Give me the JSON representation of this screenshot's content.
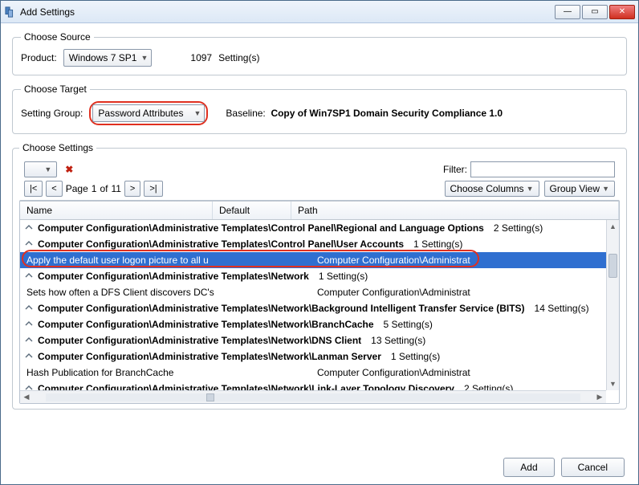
{
  "window": {
    "title": "Add Settings"
  },
  "source": {
    "legend": "Choose Source",
    "productLabel": "Product:",
    "productValue": "Windows 7 SP1",
    "count": "1097",
    "unit": "Setting(s)"
  },
  "target": {
    "legend": "Choose Target",
    "groupLabel": "Setting Group:",
    "groupValue": "Password Attributes",
    "baselineLabel": "Baseline:",
    "baselineValue": "Copy of Win7SP1 Domain Security Compliance 1.0"
  },
  "settings": {
    "legend": "Choose Settings",
    "filterLabel": "Filter:",
    "filterValue": "",
    "pageLabel": "Page",
    "pageCurrent": "1",
    "pageOf": "of",
    "pageTotal": "11",
    "chooseColumns": "Choose Columns",
    "groupView": "Group View",
    "cols": {
      "name": "Name",
      "def": "Default",
      "path": "Path"
    },
    "rows": [
      {
        "type": "group",
        "name": "Computer Configuration\\Administrative Templates\\Control Panel\\Regional and Language Options",
        "count": "2 Setting(s)"
      },
      {
        "type": "group",
        "name": "Computer Configuration\\Administrative Templates\\Control Panel\\User Accounts",
        "count": "1 Setting(s)"
      },
      {
        "type": "item",
        "selected": true,
        "name": "Apply the default user logon picture to all u",
        "path": "Computer Configuration\\Administrat"
      },
      {
        "type": "group",
        "name": "Computer Configuration\\Administrative Templates\\Network",
        "count": "1 Setting(s)"
      },
      {
        "type": "item",
        "name": "Sets how often a DFS Client discovers DC's",
        "path": "Computer Configuration\\Administrat"
      },
      {
        "type": "group",
        "name": "Computer Configuration\\Administrative Templates\\Network\\Background Intelligent Transfer Service (BITS)",
        "count": "14 Setting(s)"
      },
      {
        "type": "group",
        "name": "Computer Configuration\\Administrative Templates\\Network\\BranchCache",
        "count": "5 Setting(s)"
      },
      {
        "type": "group",
        "name": "Computer Configuration\\Administrative Templates\\Network\\DNS Client",
        "count": "13 Setting(s)"
      },
      {
        "type": "group",
        "name": "Computer Configuration\\Administrative Templates\\Network\\Lanman Server",
        "count": "1 Setting(s)"
      },
      {
        "type": "item",
        "name": "Hash Publication for BranchCache",
        "path": "Computer Configuration\\Administrat"
      },
      {
        "type": "group",
        "name": "Computer Configuration\\Administrative Templates\\Network\\Link-Layer Topology Discovery",
        "count": "2 Setting(s)"
      }
    ]
  },
  "footer": {
    "add": "Add",
    "cancel": "Cancel"
  }
}
